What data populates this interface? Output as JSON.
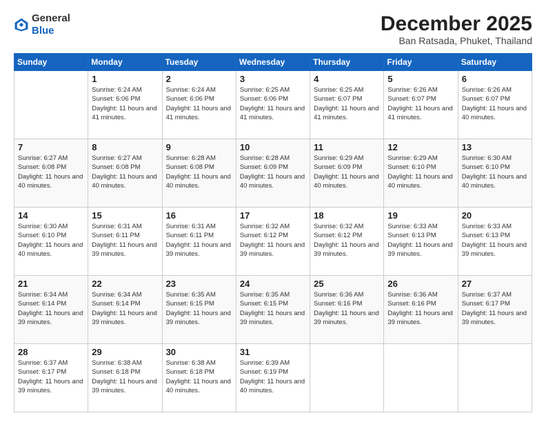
{
  "header": {
    "logo_line1": "General",
    "logo_line2": "Blue",
    "month": "December 2025",
    "location": "Ban Ratsada, Phuket, Thailand"
  },
  "weekdays": [
    "Sunday",
    "Monday",
    "Tuesday",
    "Wednesday",
    "Thursday",
    "Friday",
    "Saturday"
  ],
  "weeks": [
    [
      {
        "day": "",
        "sunrise": "",
        "sunset": "",
        "daylight": ""
      },
      {
        "day": "1",
        "sunrise": "Sunrise: 6:24 AM",
        "sunset": "Sunset: 6:06 PM",
        "daylight": "Daylight: 11 hours and 41 minutes."
      },
      {
        "day": "2",
        "sunrise": "Sunrise: 6:24 AM",
        "sunset": "Sunset: 6:06 PM",
        "daylight": "Daylight: 11 hours and 41 minutes."
      },
      {
        "day": "3",
        "sunrise": "Sunrise: 6:25 AM",
        "sunset": "Sunset: 6:06 PM",
        "daylight": "Daylight: 11 hours and 41 minutes."
      },
      {
        "day": "4",
        "sunrise": "Sunrise: 6:25 AM",
        "sunset": "Sunset: 6:07 PM",
        "daylight": "Daylight: 11 hours and 41 minutes."
      },
      {
        "day": "5",
        "sunrise": "Sunrise: 6:26 AM",
        "sunset": "Sunset: 6:07 PM",
        "daylight": "Daylight: 11 hours and 41 minutes."
      },
      {
        "day": "6",
        "sunrise": "Sunrise: 6:26 AM",
        "sunset": "Sunset: 6:07 PM",
        "daylight": "Daylight: 11 hours and 40 minutes."
      }
    ],
    [
      {
        "day": "7",
        "sunrise": "Sunrise: 6:27 AM",
        "sunset": "Sunset: 6:08 PM",
        "daylight": "Daylight: 11 hours and 40 minutes."
      },
      {
        "day": "8",
        "sunrise": "Sunrise: 6:27 AM",
        "sunset": "Sunset: 6:08 PM",
        "daylight": "Daylight: 11 hours and 40 minutes."
      },
      {
        "day": "9",
        "sunrise": "Sunrise: 6:28 AM",
        "sunset": "Sunset: 6:08 PM",
        "daylight": "Daylight: 11 hours and 40 minutes."
      },
      {
        "day": "10",
        "sunrise": "Sunrise: 6:28 AM",
        "sunset": "Sunset: 6:09 PM",
        "daylight": "Daylight: 11 hours and 40 minutes."
      },
      {
        "day": "11",
        "sunrise": "Sunrise: 6:29 AM",
        "sunset": "Sunset: 6:09 PM",
        "daylight": "Daylight: 11 hours and 40 minutes."
      },
      {
        "day": "12",
        "sunrise": "Sunrise: 6:29 AM",
        "sunset": "Sunset: 6:10 PM",
        "daylight": "Daylight: 11 hours and 40 minutes."
      },
      {
        "day": "13",
        "sunrise": "Sunrise: 6:30 AM",
        "sunset": "Sunset: 6:10 PM",
        "daylight": "Daylight: 11 hours and 40 minutes."
      }
    ],
    [
      {
        "day": "14",
        "sunrise": "Sunrise: 6:30 AM",
        "sunset": "Sunset: 6:10 PM",
        "daylight": "Daylight: 11 hours and 40 minutes."
      },
      {
        "day": "15",
        "sunrise": "Sunrise: 6:31 AM",
        "sunset": "Sunset: 6:11 PM",
        "daylight": "Daylight: 11 hours and 39 minutes."
      },
      {
        "day": "16",
        "sunrise": "Sunrise: 6:31 AM",
        "sunset": "Sunset: 6:11 PM",
        "daylight": "Daylight: 11 hours and 39 minutes."
      },
      {
        "day": "17",
        "sunrise": "Sunrise: 6:32 AM",
        "sunset": "Sunset: 6:12 PM",
        "daylight": "Daylight: 11 hours and 39 minutes."
      },
      {
        "day": "18",
        "sunrise": "Sunrise: 6:32 AM",
        "sunset": "Sunset: 6:12 PM",
        "daylight": "Daylight: 11 hours and 39 minutes."
      },
      {
        "day": "19",
        "sunrise": "Sunrise: 6:33 AM",
        "sunset": "Sunset: 6:13 PM",
        "daylight": "Daylight: 11 hours and 39 minutes."
      },
      {
        "day": "20",
        "sunrise": "Sunrise: 6:33 AM",
        "sunset": "Sunset: 6:13 PM",
        "daylight": "Daylight: 11 hours and 39 minutes."
      }
    ],
    [
      {
        "day": "21",
        "sunrise": "Sunrise: 6:34 AM",
        "sunset": "Sunset: 6:14 PM",
        "daylight": "Daylight: 11 hours and 39 minutes."
      },
      {
        "day": "22",
        "sunrise": "Sunrise: 6:34 AM",
        "sunset": "Sunset: 6:14 PM",
        "daylight": "Daylight: 11 hours and 39 minutes."
      },
      {
        "day": "23",
        "sunrise": "Sunrise: 6:35 AM",
        "sunset": "Sunset: 6:15 PM",
        "daylight": "Daylight: 11 hours and 39 minutes."
      },
      {
        "day": "24",
        "sunrise": "Sunrise: 6:35 AM",
        "sunset": "Sunset: 6:15 PM",
        "daylight": "Daylight: 11 hours and 39 minutes."
      },
      {
        "day": "25",
        "sunrise": "Sunrise: 6:36 AM",
        "sunset": "Sunset: 6:16 PM",
        "daylight": "Daylight: 11 hours and 39 minutes."
      },
      {
        "day": "26",
        "sunrise": "Sunrise: 6:36 AM",
        "sunset": "Sunset: 6:16 PM",
        "daylight": "Daylight: 11 hours and 39 minutes."
      },
      {
        "day": "27",
        "sunrise": "Sunrise: 6:37 AM",
        "sunset": "Sunset: 6:17 PM",
        "daylight": "Daylight: 11 hours and 39 minutes."
      }
    ],
    [
      {
        "day": "28",
        "sunrise": "Sunrise: 6:37 AM",
        "sunset": "Sunset: 6:17 PM",
        "daylight": "Daylight: 11 hours and 39 minutes."
      },
      {
        "day": "29",
        "sunrise": "Sunrise: 6:38 AM",
        "sunset": "Sunset: 6:18 PM",
        "daylight": "Daylight: 11 hours and 39 minutes."
      },
      {
        "day": "30",
        "sunrise": "Sunrise: 6:38 AM",
        "sunset": "Sunset: 6:18 PM",
        "daylight": "Daylight: 11 hours and 40 minutes."
      },
      {
        "day": "31",
        "sunrise": "Sunrise: 6:39 AM",
        "sunset": "Sunset: 6:19 PM",
        "daylight": "Daylight: 11 hours and 40 minutes."
      },
      {
        "day": "",
        "sunrise": "",
        "sunset": "",
        "daylight": ""
      },
      {
        "day": "",
        "sunrise": "",
        "sunset": "",
        "daylight": ""
      },
      {
        "day": "",
        "sunrise": "",
        "sunset": "",
        "daylight": ""
      }
    ]
  ]
}
